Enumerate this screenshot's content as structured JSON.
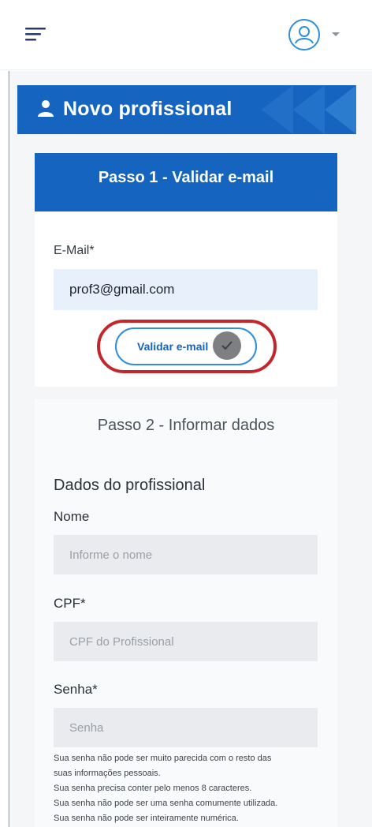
{
  "header": {
    "title": "Novo profissional"
  },
  "step1": {
    "title": "Passo 1 - Validar e-mail",
    "email_label": "E-Mail*",
    "email_value": "prof3@gmail.com",
    "validate_label": "Validar e-mail"
  },
  "step2": {
    "title": "Passo 2 - Informar dados",
    "section_title": "Dados do profissional",
    "fields": [
      {
        "label": "Nome",
        "placeholder": "Informe o nome"
      },
      {
        "label": "CPF*",
        "placeholder": "CPF do Profissional"
      },
      {
        "label": "Senha*",
        "placeholder": "Senha"
      }
    ],
    "password_hints": [
      "Sua senha não pode ser muito parecida com o resto das",
      "suas informações pessoais.",
      "Sua senha precisa conter pelo menos 8 caracteres.",
      "Sua senha não pode ser uma senha comumente utilizada.",
      "Sua senha não pode ser inteiramente numérica."
    ]
  },
  "colors": {
    "brand_blue": "#1565c0",
    "accent_blue": "#2f8fdc",
    "highlight_red": "#c0282d"
  },
  "icons": {
    "menu": "menu-icon",
    "user": "user-avatar-icon",
    "caret": "chevron-down-icon",
    "person": "person-icon",
    "check": "check-icon"
  }
}
